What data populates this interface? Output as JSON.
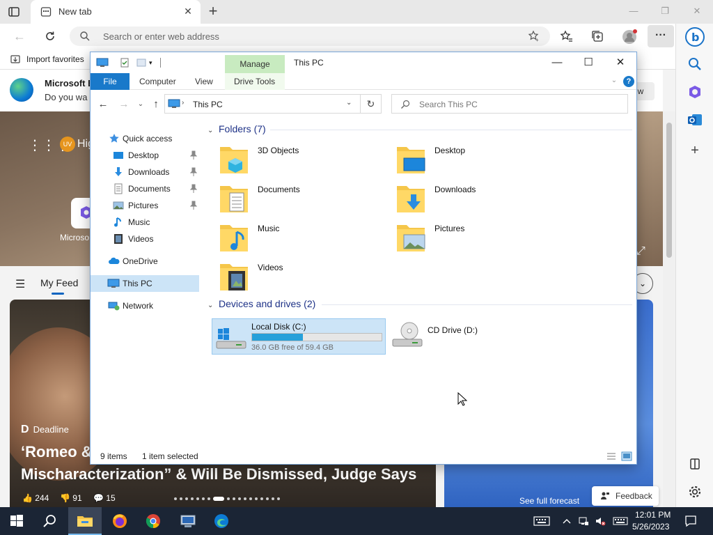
{
  "browser": {
    "tab_title": "New tab",
    "address_placeholder": "Search or enter web address",
    "import_favorites": "Import favorites"
  },
  "page": {
    "promo_title": "Microsoft E",
    "promo_sub": "Do you wa",
    "promo_button": "w",
    "hero_greeting": "Hig",
    "uv_badge": "UV",
    "quicklink_label": "Microso",
    "feed_tab": "My Feed",
    "news_source": "Deadline",
    "news_headline_1": "‘Romeo &",
    "news_headline_2": "Mischaracterization” & Will Be Dismissed, Judge Says",
    "news_likes": "244",
    "news_dislikes": "91",
    "news_comments": "15",
    "weather_link": "See full forecast",
    "feedback_label": "Feedback"
  },
  "explorer": {
    "title": "This PC",
    "manage_tab": "Manage",
    "ribbon_tabs": {
      "file": "File",
      "computer": "Computer",
      "view": "View",
      "drive_tools": "Drive Tools"
    },
    "breadcrumb": "This PC",
    "search_placeholder": "Search This PC",
    "nav": {
      "quick_access": "Quick access",
      "desktop": "Desktop",
      "downloads": "Downloads",
      "documents": "Documents",
      "pictures": "Pictures",
      "music": "Music",
      "videos": "Videos",
      "onedrive": "OneDrive",
      "this_pc": "This PC",
      "network": "Network"
    },
    "folders_header": "Folders (7)",
    "folders": [
      "3D Objects",
      "Desktop",
      "Documents",
      "Downloads",
      "Music",
      "Pictures",
      "Videos"
    ],
    "drives_header": "Devices and drives (2)",
    "drives": [
      {
        "name": "Local Disk (C:)",
        "free": "36.0 GB free of 59.4 GB",
        "used_fraction": 0.394
      },
      {
        "name": "CD Drive (D:)"
      }
    ],
    "status_items": "9 items",
    "status_selected": "1 item selected"
  },
  "taskbar": {
    "time": "12:01 PM",
    "date": "5/26/2023"
  },
  "colors": {
    "accent": "#1979ca",
    "selection": "#cce4f7",
    "manage_tab": "#c8ebc0",
    "group_header": "#1e3287",
    "drive_bar": "#26a0da",
    "taskbar": "#1b2535"
  }
}
